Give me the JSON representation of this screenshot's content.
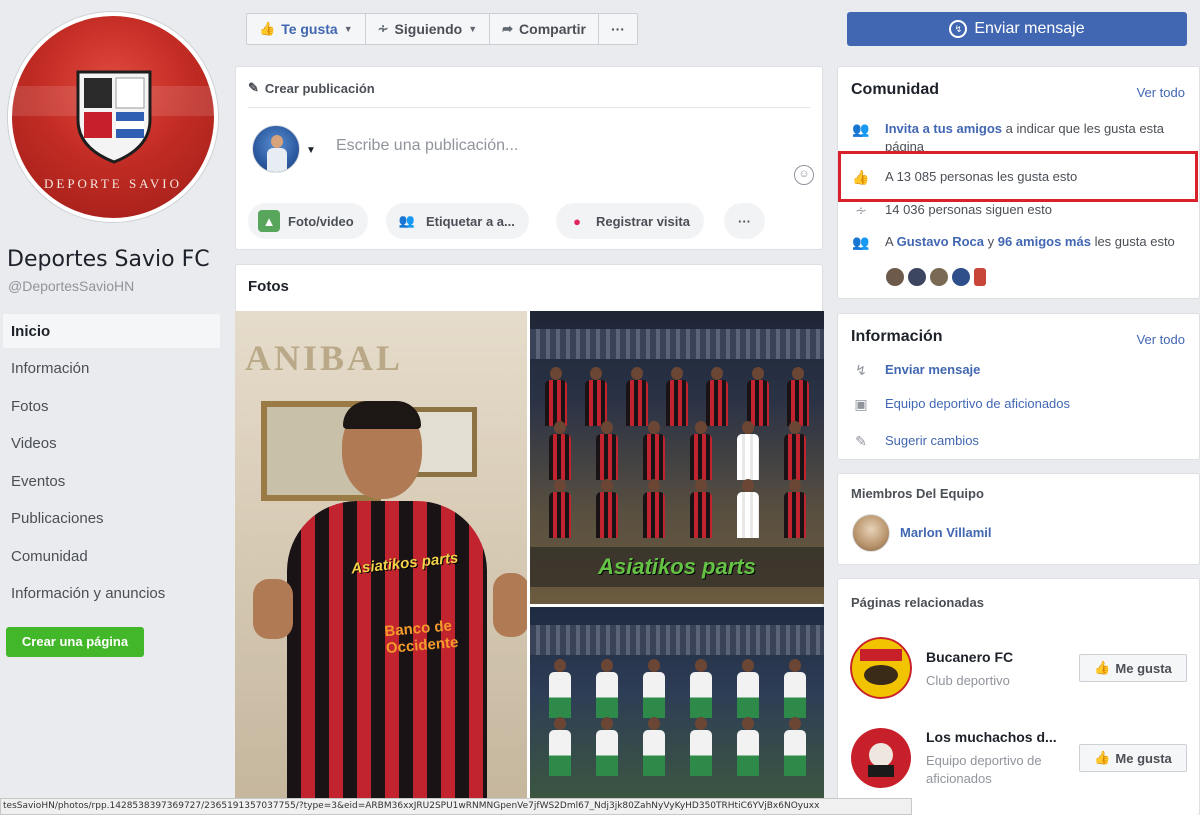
{
  "page": {
    "name": "Deportes Savio FC",
    "handle": "@DeportesSavioHN",
    "crest_text": "DEPORTE SAVIO"
  },
  "nav": {
    "items": [
      "Inicio",
      "Información",
      "Fotos",
      "Videos",
      "Eventos",
      "Publicaciones",
      "Comunidad",
      "Información y anuncios"
    ],
    "active_index": 0
  },
  "create_page_label": "Crear una página",
  "action_bar": {
    "like_label": "Te gusta",
    "following_label": "Siguiendo",
    "share_label": "Compartir",
    "more_label": "···"
  },
  "send_message_label": "Enviar mensaje",
  "composer": {
    "header": "Crear publicación",
    "placeholder": "Escribe una publicación...",
    "photo_video": "Foto/video",
    "tag": "Etiquetar a a...",
    "checkin": "Registrar visita",
    "more": "···"
  },
  "photos": {
    "title": "Fotos",
    "photo1_sign": "ANIBAL",
    "photo1_shirt1": "Asiatikos parts",
    "photo1_shirt2": "Banco de Occidente",
    "photo2_banner": "Asiatikos parts"
  },
  "community": {
    "title": "Comunidad",
    "see_all": "Ver todo",
    "invite_link": "Invita a tus amigos",
    "invite_rest": " a indicar que les gusta esta página",
    "likes": "A 13 085 personas les gusta esto",
    "followers": "14 036 personas siguen esto",
    "friends_prefix": "A ",
    "friend1": "Gustavo Roca",
    "friends_mid": " y ",
    "friend2": "96 amigos más",
    "friends_suffix": " les gusta esto"
  },
  "info": {
    "title": "Información",
    "see_all": "Ver todo",
    "send_message": "Enviar mensaje",
    "category": "Equipo deportivo de aficionados",
    "suggest": "Sugerir cambios"
  },
  "members": {
    "title": "Miembros Del Equipo",
    "name": "Marlon Villamil"
  },
  "related": {
    "title": "Páginas relacionadas",
    "pages": [
      {
        "name": "Bucanero FC",
        "sub": "Club deportivo",
        "button": "Me gusta"
      },
      {
        "name": "Los muchachos d...",
        "sub": "Equipo deportivo de aficionados",
        "button": "Me gusta"
      }
    ]
  },
  "status_url": "tesSavioHN/photos/rpp.142853839736972​7/2365191357037755/?type=3&eid=ARBM36xxJRU2SPU1wRNMNGpenVe7jfWS2Dml67_Ndj3jk80ZahNyVyKyHD350TRHtiC6YVjBx6NOyuxx",
  "colors": {
    "brand_blue": "#4267b2",
    "create_green": "#42b72a",
    "highlight_red": "#d9202b"
  }
}
